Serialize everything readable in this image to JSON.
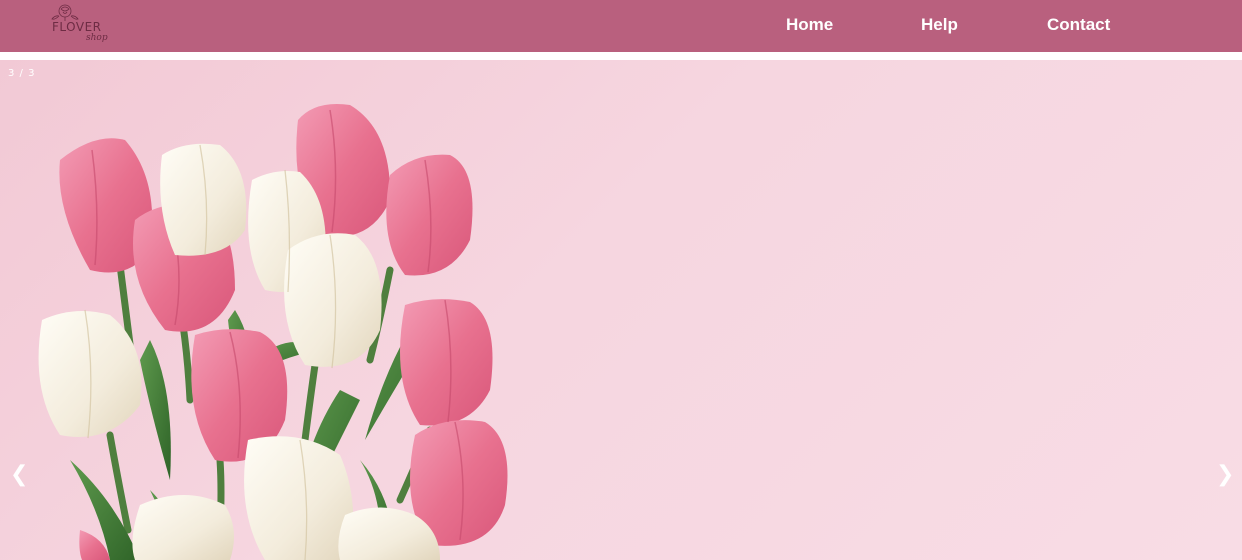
{
  "header": {
    "logo_text": "FLOVER",
    "logo_sub": "shop",
    "nav": {
      "home": "Home",
      "help": "Help",
      "contact": "Contact"
    }
  },
  "slideshow": {
    "counter": "3 / 3",
    "prev_label": "❮",
    "next_label": "❯",
    "image_subject": "pink and white tulip bouquet on pink background"
  },
  "colors": {
    "navbar": "#b9607e",
    "slide_background": "#f6d6e0",
    "tulip_pink": "#e8718f",
    "tulip_white": "#f5efe2",
    "leaf_green": "#3f7a36"
  }
}
